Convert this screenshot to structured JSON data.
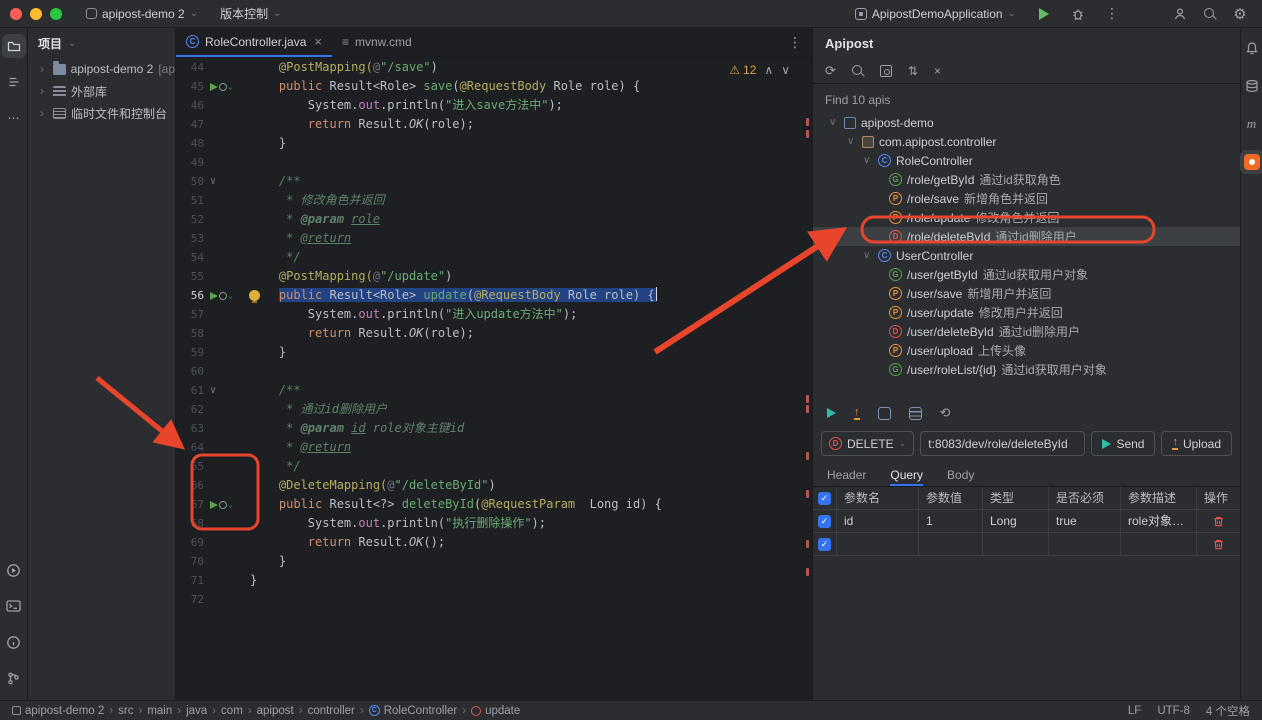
{
  "colors": {
    "accent_blue": "#3574f0",
    "annotation_red": "#e8452c",
    "apipost_orange": "#f06a23",
    "method_get": "#57a64a",
    "method_post": "#e8973c",
    "method_delete": "#e5534b"
  },
  "titlebar": {
    "project_selector": "apipost-demo 2",
    "vcs_label": "版本控制",
    "run_config": "ApipostDemoApplication"
  },
  "project_panel": {
    "header": "项目",
    "items": [
      {
        "label": "apipost-demo 2 ",
        "suffix": "[ap",
        "icon": "project-folder"
      },
      {
        "label": "外部库",
        "icon": "libraries"
      },
      {
        "label": "临时文件和控制台",
        "icon": "scratches"
      }
    ]
  },
  "editor": {
    "tabs": [
      {
        "label": "RoleController.java",
        "icon": "class",
        "active": true
      },
      {
        "label": "mvnw.cmd",
        "icon": "text",
        "active": false
      }
    ],
    "inspection": {
      "warnings": "12"
    },
    "code": [
      {
        "n": 44,
        "segs": [
          [
            "ind",
            "    "
          ],
          [
            "ann",
            "@PostMapping("
          ],
          [
            "inl",
            "@"
          ],
          [
            "str",
            "\"/save\""
          ],
          [
            "d",
            ")"
          ]
        ]
      },
      {
        "n": 45,
        "g": "api",
        "segs": [
          [
            "ind",
            "    "
          ],
          [
            "kw",
            "public "
          ],
          [
            "d",
            "Result<Role> "
          ],
          [
            "fn",
            "save"
          ],
          [
            "d",
            "("
          ],
          [
            "ann",
            "@RequestBody"
          ],
          [
            "d",
            " Role role) {"
          ]
        ]
      },
      {
        "n": 46,
        "segs": [
          [
            "ind",
            "        "
          ],
          [
            "d",
            "System."
          ],
          [
            "fld",
            "out"
          ],
          [
            "d",
            ".println("
          ],
          [
            "str",
            "\"进入save方法中\""
          ],
          [
            "d",
            ");"
          ]
        ]
      },
      {
        "n": 47,
        "segs": [
          [
            "ind",
            "        "
          ],
          [
            "kw",
            "return "
          ],
          [
            "d",
            "Result."
          ],
          [
            "sm",
            "OK"
          ],
          [
            "d",
            "(role);"
          ]
        ]
      },
      {
        "n": 48,
        "segs": [
          [
            "ind",
            "    "
          ],
          [
            "d",
            "}"
          ]
        ]
      },
      {
        "n": 49,
        "segs": []
      },
      {
        "n": 50,
        "fold": true,
        "segs": [
          [
            "ind",
            "    "
          ],
          [
            "doc",
            "/**"
          ]
        ]
      },
      {
        "n": 51,
        "segs": [
          [
            "ind",
            "     "
          ],
          [
            "doc",
            "* 修改角色并返回"
          ]
        ]
      },
      {
        "n": 52,
        "segs": [
          [
            "ind",
            "     "
          ],
          [
            "doc",
            "* "
          ],
          [
            "dt",
            "@param"
          ],
          [
            "doc",
            " "
          ],
          [
            "du",
            "role"
          ]
        ]
      },
      {
        "n": 53,
        "segs": [
          [
            "ind",
            "     "
          ],
          [
            "doc",
            "* "
          ],
          [
            "du",
            "@return"
          ]
        ]
      },
      {
        "n": 54,
        "segs": [
          [
            "ind",
            "     "
          ],
          [
            "doc",
            "*/"
          ]
        ]
      },
      {
        "n": 55,
        "segs": [
          [
            "ind",
            "    "
          ],
          [
            "ann",
            "@PostMapping("
          ],
          [
            "inl",
            "@"
          ],
          [
            "str",
            "\"/update\""
          ],
          [
            "d",
            ")"
          ]
        ]
      },
      {
        "n": 56,
        "g": "api",
        "sel": true,
        "bulb": true,
        "segs": [
          [
            "ind",
            "    "
          ],
          [
            "kw",
            "public "
          ],
          [
            "d",
            "Result<Role> "
          ],
          [
            "fn",
            "update"
          ],
          [
            "d",
            "("
          ],
          [
            "ann",
            "@RequestBody"
          ],
          [
            "d",
            " Role role) {"
          ]
        ]
      },
      {
        "n": 57,
        "segs": [
          [
            "ind",
            "        "
          ],
          [
            "d",
            "System."
          ],
          [
            "fld",
            "out"
          ],
          [
            "d",
            ".println("
          ],
          [
            "str",
            "\"进入update方法中\""
          ],
          [
            "d",
            ");"
          ]
        ]
      },
      {
        "n": 58,
        "segs": [
          [
            "ind",
            "        "
          ],
          [
            "kw",
            "return "
          ],
          [
            "d",
            "Result."
          ],
          [
            "sm",
            "OK"
          ],
          [
            "d",
            "(role);"
          ]
        ]
      },
      {
        "n": 59,
        "segs": [
          [
            "ind",
            "    "
          ],
          [
            "d",
            "}"
          ]
        ]
      },
      {
        "n": 60,
        "segs": []
      },
      {
        "n": 61,
        "fold": true,
        "segs": [
          [
            "ind",
            "    "
          ],
          [
            "doc",
            "/**"
          ]
        ]
      },
      {
        "n": 62,
        "segs": [
          [
            "ind",
            "     "
          ],
          [
            "doc",
            "* 通过id删除用户"
          ]
        ]
      },
      {
        "n": 63,
        "segs": [
          [
            "ind",
            "     "
          ],
          [
            "doc",
            "* "
          ],
          [
            "dt",
            "@param"
          ],
          [
            "doc",
            " "
          ],
          [
            "du",
            "id"
          ],
          [
            "doc",
            " role对象主键id"
          ]
        ]
      },
      {
        "n": 64,
        "segs": [
          [
            "ind",
            "     "
          ],
          [
            "doc",
            "* "
          ],
          [
            "du",
            "@return"
          ]
        ]
      },
      {
        "n": 65,
        "segs": [
          [
            "ind",
            "     "
          ],
          [
            "doc",
            "*/"
          ]
        ]
      },
      {
        "n": 66,
        "segs": [
          [
            "ind",
            "    "
          ],
          [
            "ann",
            "@DeleteMapping("
          ],
          [
            "inl",
            "@"
          ],
          [
            "str",
            "\"/deleteById\""
          ],
          [
            "d",
            ")"
          ]
        ]
      },
      {
        "n": 67,
        "g": "api",
        "segs": [
          [
            "ind",
            "    "
          ],
          [
            "kw",
            "public "
          ],
          [
            "d",
            "Result<?> "
          ],
          [
            "fn",
            "deleteById"
          ],
          [
            "d",
            "("
          ],
          [
            "ann",
            "@RequestParam"
          ],
          [
            "d",
            "  Long id) {"
          ]
        ]
      },
      {
        "n": 68,
        "segs": [
          [
            "ind",
            "        "
          ],
          [
            "d",
            "System."
          ],
          [
            "fld",
            "out"
          ],
          [
            "d",
            ".println("
          ],
          [
            "str",
            "\"执行删除操作\""
          ],
          [
            "d",
            ");"
          ]
        ]
      },
      {
        "n": 69,
        "segs": [
          [
            "ind",
            "        "
          ],
          [
            "kw",
            "return "
          ],
          [
            "d",
            "Result."
          ],
          [
            "sm",
            "OK"
          ],
          [
            "d",
            "();"
          ]
        ]
      },
      {
        "n": 70,
        "segs": [
          [
            "ind",
            "    "
          ],
          [
            "d",
            "}"
          ]
        ]
      },
      {
        "n": 71,
        "segs": [
          [
            "d",
            "}"
          ]
        ]
      },
      {
        "n": 72,
        "segs": []
      }
    ]
  },
  "apipost": {
    "title": "Apipost",
    "find_label": "Find 10 apis",
    "tree": [
      {
        "label": "apipost-demo",
        "icon": "module",
        "level": 0,
        "expanded": true
      },
      {
        "label": "com.apipost.controller",
        "icon": "package",
        "level": 1,
        "expanded": true
      },
      {
        "label": "RoleController",
        "icon": "class",
        "level": 2,
        "expanded": true
      },
      {
        "path": "/role/getById",
        "desc": "通过id获取角色",
        "method": "G",
        "level": 3
      },
      {
        "path": "/role/save",
        "desc": "新增角色并返回",
        "method": "P",
        "level": 3
      },
      {
        "path": "/role/update",
        "desc": "修改角色并返回",
        "method": "P",
        "level": 3
      },
      {
        "path": "/role/deleteById",
        "desc": "通过id删除用户",
        "method": "D",
        "level": 3,
        "selected": true
      },
      {
        "label": "UserController",
        "icon": "class",
        "level": 2,
        "expanded": true
      },
      {
        "path": "/user/getById",
        "desc": "通过id获取用户对象",
        "method": "G",
        "level": 3
      },
      {
        "path": "/user/save",
        "desc": "新增用户并返回",
        "method": "P",
        "level": 3
      },
      {
        "path": "/user/update",
        "desc": "修改用户并返回",
        "method": "P",
        "level": 3
      },
      {
        "path": "/user/deleteById",
        "desc": "通过id删除用户",
        "method": "D",
        "level": 3
      },
      {
        "path": "/user/upload",
        "desc": "上传头像",
        "method": "P",
        "level": 3
      },
      {
        "path": "/user/roleList/{id}",
        "desc": "通过id获取用户对象",
        "method": "G",
        "level": 3
      }
    ],
    "request": {
      "method": "DELETE",
      "url": "t:8083/dev/role/deleteById",
      "send_label": "Send",
      "upload_label": "Upload"
    },
    "tabs": [
      "Header",
      "Query",
      "Body"
    ],
    "active_tab": "Query",
    "table": {
      "headers": [
        "参数名",
        "参数值",
        "类型",
        "是否必须",
        "参数描述",
        "操作"
      ],
      "rows": [
        {
          "checked": true,
          "cells": [
            "id",
            "1",
            "Long",
            "true",
            "role对象主..."
          ]
        },
        {
          "checked": true,
          "cells": [
            "",
            "",
            "",
            "",
            ""
          ]
        }
      ]
    }
  },
  "statusbar": {
    "breadcrumbs": [
      {
        "label": "apipost-demo 2",
        "icon": "proj"
      },
      {
        "label": "src"
      },
      {
        "label": "main"
      },
      {
        "label": "java"
      },
      {
        "label": "com"
      },
      {
        "label": "apipost"
      },
      {
        "label": "controller"
      },
      {
        "label": "RoleController",
        "icon": "class"
      },
      {
        "label": "update",
        "icon": "method"
      }
    ],
    "line_sep": "LF",
    "encoding": "UTF-8",
    "indent": "4 个空格"
  }
}
